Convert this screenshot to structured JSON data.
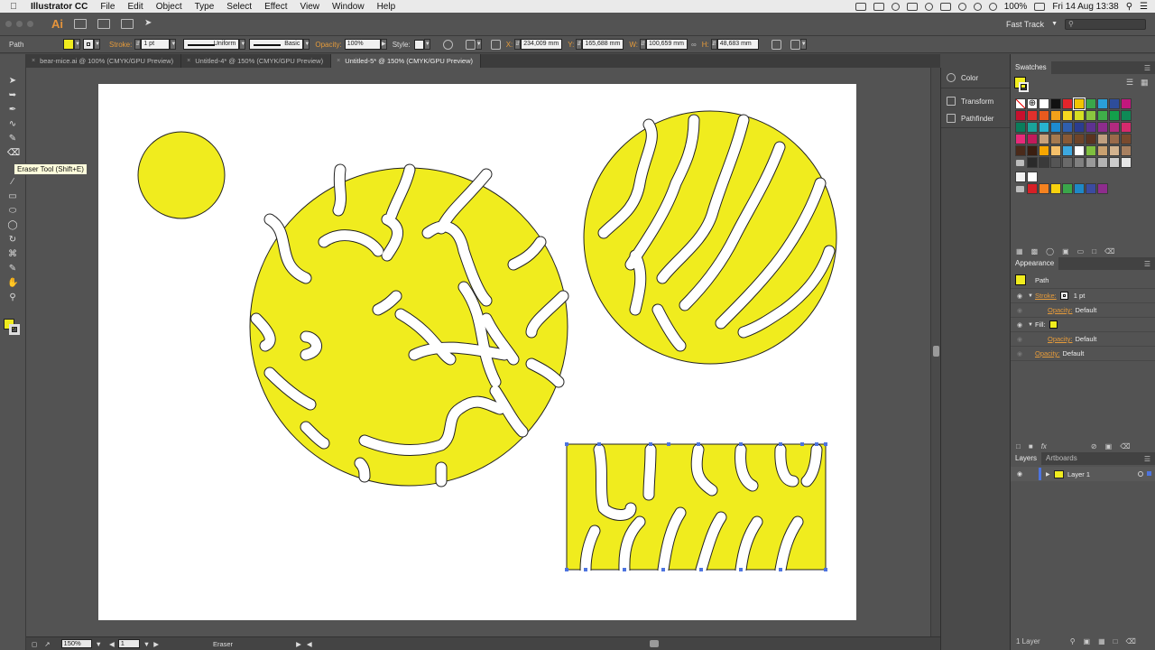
{
  "menubar": {
    "items": [
      "Illustrator CC",
      "File",
      "Edit",
      "Object",
      "Type",
      "Select",
      "Effect",
      "View",
      "Window",
      "Help"
    ],
    "battery": "100%",
    "clock": "Fri 14 Aug  13:38"
  },
  "appbar": {
    "logo": "Ai",
    "workspace": "Fast Track",
    "search_placeholder": ""
  },
  "controlbar": {
    "selection_label": "Path",
    "fill_color": "#f0ec1e",
    "stroke_label": "Stroke:",
    "stroke_weight": "1 pt",
    "profile": "Uniform",
    "brush": "Basic",
    "opacity_label": "Opacity:",
    "opacity_value": "100%",
    "style_label": "Style:",
    "x_label": "X:",
    "x_value": "234,009 mm",
    "y_label": "Y:",
    "y_value": "165,688 mm",
    "w_label": "W:",
    "w_value": "100,659 mm",
    "h_label": "H:",
    "h_value": "48,683 mm"
  },
  "tabs": [
    {
      "label": "bear-mice.ai @ 100% (CMYK/GPU Preview)",
      "active": false
    },
    {
      "label": "Untitled-4* @ 150% (CMYK/GPU Preview)",
      "active": false
    },
    {
      "label": "Untitled-5* @ 150% (CMYK/GPU Preview)",
      "active": true
    }
  ],
  "tooltip": "Eraser Tool (Shift+E)",
  "status": {
    "zoom": "150%",
    "artboard": "1",
    "tool": "Eraser"
  },
  "collapsed_panels": [
    {
      "label": "Color",
      "icon": "color-icon"
    },
    {
      "label": "Transform",
      "icon": "transform-icon"
    },
    {
      "label": "Pathfinder",
      "icon": "pathfinder-icon"
    }
  ],
  "swatches": {
    "title": "Swatches",
    "fill_color": "#f0ec1e"
  },
  "appearance": {
    "title": "Appearance",
    "object": "Path",
    "stroke_label": "Stroke:",
    "stroke_weight": "1 pt",
    "opacity_label": "Opacity:",
    "opacity_value": "Default",
    "fill_label": "Fill:",
    "fill_opacity_label": "Opacity:",
    "fill_opacity_value": "Default",
    "global_opacity_label": "Opacity:",
    "global_opacity_value": "Default"
  },
  "layers": {
    "tab1": "Layers",
    "tab2": "Artboards",
    "layer_name": "Layer 1",
    "count": "1 Layer"
  },
  "art_color": "#f0ec1e"
}
